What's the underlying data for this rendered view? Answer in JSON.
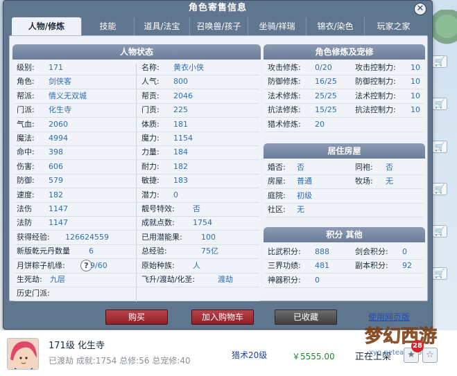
{
  "dialog": {
    "title": "角色寄售信息",
    "close_glyph": "✕"
  },
  "tabs": [
    "人物/修炼",
    "技能",
    "道具/法宝",
    "召唤兽/孩子",
    "坐骑/祥瑞",
    "锦衣/染色",
    "玩家之家"
  ],
  "status": {
    "header": "人物状态",
    "rows": [
      [
        [
          "级别:",
          "171"
        ],
        [
          "名称:",
          "黄衣小侠"
        ]
      ],
      [
        [
          "角色:",
          "剑侠客"
        ],
        [
          "人气:",
          "800"
        ]
      ],
      [
        [
          "帮派:",
          "情义无双城"
        ],
        [
          "帮贡:",
          "2046"
        ]
      ],
      [
        [
          "门派:",
          "化生寺"
        ],
        [
          "门贡:",
          "225"
        ]
      ],
      [
        [
          "气血:",
          "2060"
        ],
        [
          "体质:",
          "181"
        ]
      ],
      [
        [
          "魔法:",
          "4994"
        ],
        [
          "魔力:",
          "1154"
        ]
      ],
      [
        [
          "命中:",
          "398"
        ],
        [
          "力量:",
          "184"
        ]
      ],
      [
        [
          "伤害:",
          "606"
        ],
        [
          "耐力:",
          "182"
        ]
      ],
      [
        [
          "防御:",
          "579"
        ],
        [
          "敏捷:",
          "183"
        ]
      ],
      [
        [
          "速度:",
          "182"
        ],
        [
          "潜力:",
          "0"
        ]
      ],
      [
        [
          "法伤",
          "1147"
        ],
        [
          "靓号特效:",
          "否"
        ]
      ],
      [
        [
          "法防",
          "1147"
        ],
        [
          "成就点数:",
          "1754"
        ]
      ],
      [
        [
          "获得经验:",
          "126624559"
        ],
        [
          "已用潜能果:",
          "100"
        ]
      ],
      [
        [
          "新版乾元丹数量",
          "6"
        ],
        [
          "总经验:",
          "75亿"
        ]
      ],
      [
        [
          "月饼粽子机缘:",
          "9/60"
        ],
        [
          "原始种族:",
          "人"
        ]
      ],
      [
        [
          "生死劫:",
          "九层"
        ],
        [
          "飞升/渡劫/化圣:",
          "渡劫"
        ]
      ],
      [
        [
          "历史门派:",
          ""
        ],
        [
          "",
          ""
        ]
      ]
    ]
  },
  "cultivation": {
    "header": "角色修炼及宠修",
    "rows": [
      [
        [
          "攻击修炼:",
          "0/20"
        ],
        [
          "攻击控制力:",
          "10"
        ]
      ],
      [
        [
          "防御修炼:",
          "16/25"
        ],
        [
          "防御控制力:",
          "10"
        ]
      ],
      [
        [
          "法术修炼:",
          "25/25"
        ],
        [
          "法术控制力:",
          "10"
        ]
      ],
      [
        [
          "抗法修炼:",
          "15/25"
        ],
        [
          "抗法控制力:",
          "10"
        ]
      ],
      [
        [
          "猎术修炼:",
          "20"
        ],
        [
          "",
          ""
        ]
      ]
    ]
  },
  "housing": {
    "header": "居住房屋",
    "rows": [
      [
        [
          "婚否:",
          "否"
        ],
        [
          "同袍:",
          "否"
        ]
      ],
      [
        [
          "房屋:",
          "普通"
        ],
        [
          "牧场:",
          "无"
        ]
      ],
      [
        [
          "庭院:",
          "初级"
        ],
        [
          "",
          ""
        ]
      ],
      [
        [
          "社区:",
          "无"
        ],
        [
          "",
          ""
        ]
      ]
    ]
  },
  "points": {
    "header": "积分 其他",
    "rows": [
      [
        [
          "比武积分:",
          "888"
        ],
        [
          "剑会积分:",
          "0"
        ]
      ],
      [
        [
          "三界功绩:",
          "481"
        ],
        [
          "副本积分:",
          "92"
        ]
      ],
      [
        [
          "神器积分:",
          "0"
        ],
        [
          "",
          ""
        ]
      ]
    ]
  },
  "actions": {
    "buy": "购买",
    "add_cart": "加入购物车",
    "collected": "已收藏",
    "web_version": "使用网页版"
  },
  "listing": {
    "level_school": "171级 化生寺",
    "details": "已渡劫 成就:1754 总修:56 总宠修:40",
    "hunting": "猎术20级",
    "price": "￥5555.00",
    "status": "正在上架",
    "badge_count": "28",
    "logo_domain": "xyq.netease.com"
  },
  "colors": {
    "value_blue": "#2d6db5",
    "price_green": "#1f8a2e",
    "button_red": "#a3323a",
    "header_slate": "#7a8ba4"
  }
}
